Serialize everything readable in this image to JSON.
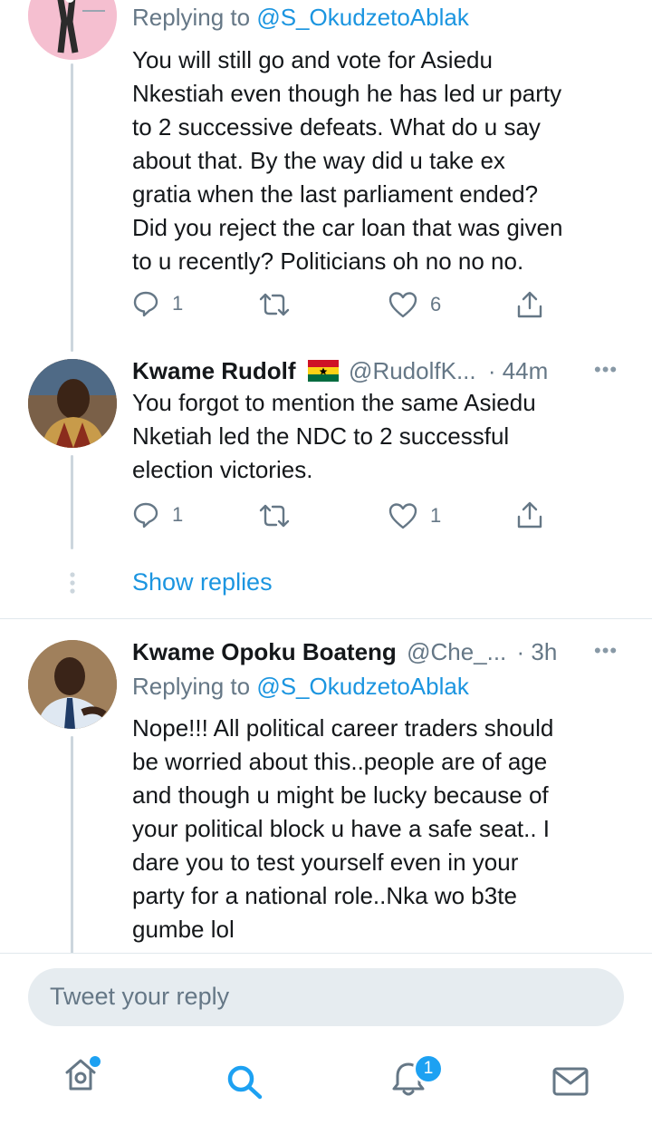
{
  "tweet1": {
    "replying_prefix": "Replying to ",
    "replying_handle": "@S_OkudzetoAblak",
    "lines": [
      "You will still go and vote for Asiedu",
      "Nkestiah even though he has led ur party",
      "to 2 successive defeats. What do u say",
      "about that. By the way did u take ex",
      "gratia when the last parliament ended?",
      "Did you reject the car loan that was given",
      "to u recently? Politicians oh no no no."
    ],
    "reply_count": "1",
    "like_count": "6"
  },
  "tweet2": {
    "name": "Kwame Rudolf",
    "flag_icon": "ghana-flag-icon",
    "handle": "@RudolfK...",
    "time": "· 44m",
    "lines": [
      "You forgot to mention the same Asiedu",
      "Nketiah led the NDC to 2 successful",
      "election victories."
    ],
    "reply_count": "1",
    "like_count": "1"
  },
  "show_replies": "Show replies",
  "tweet3": {
    "name": "Kwame Opoku Boateng",
    "handle": "@Che_...",
    "time": "· 3h",
    "replying_prefix": "Replying to ",
    "replying_handle": "@S_OkudzetoAblak",
    "lines": [
      "Nope!!! All political career traders should",
      "be worried about this..people are of age",
      "and though u might be lucky because of",
      "your political block u have a safe seat.. I",
      "dare you to test yourself even in your",
      "party for a national role..Nka wo b3te",
      "gumbe lol"
    ]
  },
  "more_glyph": "•••",
  "reply_placeholder": "Tweet your reply",
  "nav": {
    "notification_badge": "1"
  },
  "colors": {
    "accent": "#1da1f2",
    "link": "#1b95e0",
    "muted": "#657786",
    "line": "#ccd6dd"
  }
}
